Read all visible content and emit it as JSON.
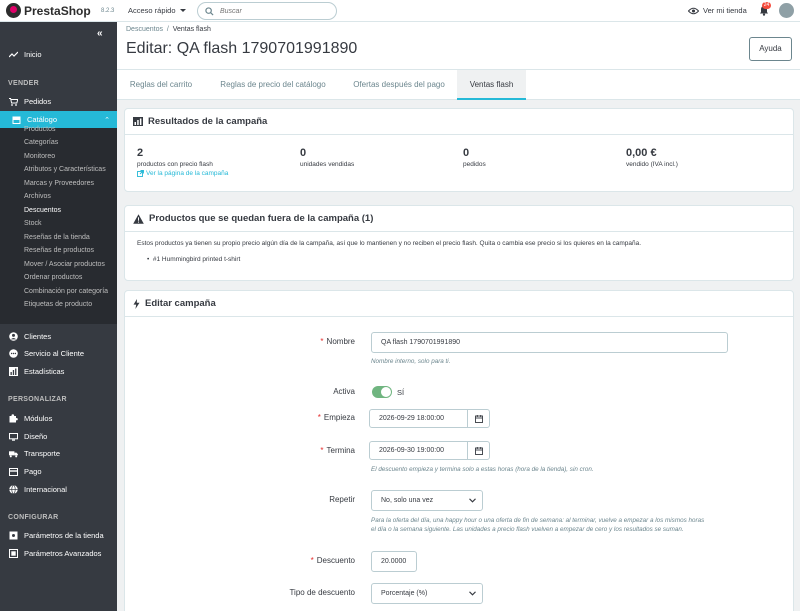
{
  "header": {
    "brand": "PrestaShop",
    "version": "8.2.3",
    "quick_access": "Acceso rápido",
    "search_placeholder": "Buscar",
    "view_store": "Ver mi tienda",
    "notif_count": "24"
  },
  "sidebar": {
    "home": "Inicio",
    "sections": {
      "sell": "VENDER",
      "customize": "PERSONALIZAR",
      "configure": "CONFIGURAR"
    },
    "sell_items": [
      {
        "label": "Pedidos",
        "icon": "cart-icon"
      },
      {
        "label": "Catálogo",
        "icon": "store-icon"
      }
    ],
    "catalog_sub": [
      "Productos",
      "Categorías",
      "Monitoreo",
      "Atributos y Características",
      "Marcas y Proveedores",
      "Archivos",
      "Descuentos",
      "Stock",
      "Reseñas de la tienda",
      "Reseñas de productos",
      "Mover / Asociar productos",
      "Ordenar productos",
      "Combinación por categoría",
      "Etiquetas de producto"
    ],
    "after_catalog": [
      {
        "label": "Clientes",
        "icon": "user-icon"
      },
      {
        "label": "Servicio al Cliente",
        "icon": "chat-icon"
      },
      {
        "label": "Estadísticas",
        "icon": "stats-icon"
      }
    ],
    "customize_items": [
      {
        "label": "Módulos",
        "icon": "puzzle-icon"
      },
      {
        "label": "Diseño",
        "icon": "desktop-icon"
      },
      {
        "label": "Transporte",
        "icon": "truck-icon"
      },
      {
        "label": "Pago",
        "icon": "card-icon"
      },
      {
        "label": "Internacional",
        "icon": "globe-icon"
      }
    ],
    "configure_items": [
      {
        "label": "Parámetros de la tienda",
        "icon": "settings-icon"
      },
      {
        "label": "Parámetros Avanzados",
        "icon": "advanced-icon"
      }
    ]
  },
  "page": {
    "breadcrumb": [
      "Descuentos",
      "Ventas flash"
    ],
    "title": "Editar: QA flash 1790701991890",
    "help": "Ayuda"
  },
  "tabs": [
    "Reglas del carrito",
    "Reglas de precio del catálogo",
    "Ofertas después del pago",
    "Ventas flash"
  ],
  "results": {
    "title": "Resultados de la campaña",
    "stats": [
      {
        "value": "2",
        "label": "productos con precio flash"
      },
      {
        "value": "0",
        "label": "unidades vendidas"
      },
      {
        "value": "0",
        "label": "pedidos"
      },
      {
        "value": "0,00 €",
        "label": "vendido (IVA incl.)"
      }
    ],
    "link": "Ver la página de la campaña"
  },
  "excluded": {
    "title": "Productos que se quedan fuera de la campaña (1)",
    "text": "Estos productos ya tienen su propio precio algún día de la campaña, así que lo mantienen y no reciben el precio flash. Quita o cambia ese precio si los quieres en la campaña.",
    "items": [
      "#1 Hummingbird printed t-shirt"
    ]
  },
  "edit": {
    "title": "Editar campaña",
    "name_label": "Nombre",
    "name_value": "QA flash 1790701991890",
    "name_help": "Nombre interno, solo para ti.",
    "active_label": "Activa",
    "active_value": "SÍ",
    "start_label": "Empieza",
    "start_value": "2026-09-29 18:00:00",
    "end_label": "Termina",
    "end_value": "2026-09-30 19:00:00",
    "dates_help": "El descuento empieza y termina solo a estas horas (hora de la tienda), sin cron.",
    "repeat_label": "Repetir",
    "repeat_value": "No, solo una vez",
    "repeat_help_1": "Para la oferta del día, una happy hour o una oferta de fin de semana: al terminar, vuelve a empezar a los mismos horas",
    "repeat_help_2": "el día o la semana siguiente. Las unidades a precio flash vuelven a empezar de cero y los resultados se suman.",
    "discount_label": "Descuento",
    "discount_value": "20.0000",
    "type_label": "Tipo de descuento",
    "type_value": "Porcentaje (%)"
  },
  "colors": {
    "accent": "#25b9d7",
    "sidebar": "#363a41",
    "toggle_on": "#70b580",
    "required": "#e42b2b"
  }
}
